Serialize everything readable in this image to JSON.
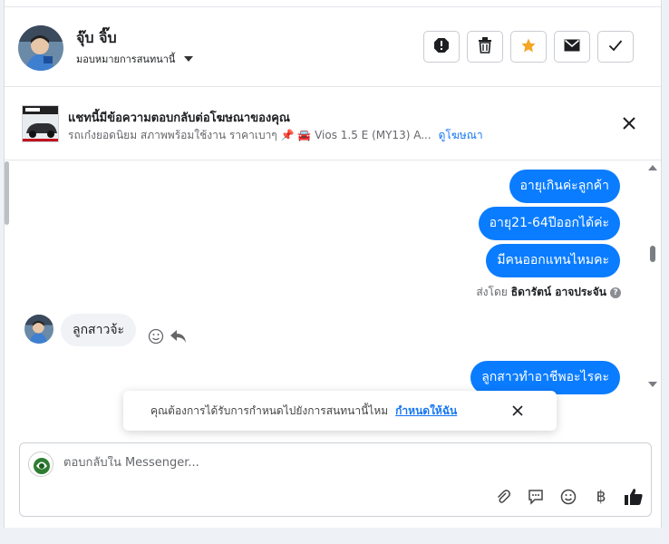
{
  "header": {
    "contact_name": "จุ๊บ จิ๊บ",
    "assign_label": "มอบหมายการสนทนานี้",
    "buttons": {
      "spam": "spam-icon",
      "delete": "trash-icon",
      "star": "star-icon",
      "mail": "envelope-icon",
      "done": "check-icon"
    }
  },
  "ad_bar": {
    "title": "แชทนี้มีข้อความตอบกลับต่อโฆษณาของคุณ",
    "subtitle": "รถเก๋งยอดนิยม สภาพพร้อมใช้งาน ราคาเบาๆ 📌 🚘 Vios 1.5 E (MY13) A...",
    "link": "ดูโฆษณา"
  },
  "messages": {
    "outgoing_top": [
      "อายุเกินค่ะลูกค้า",
      "อายุ21-64ปีออกได้ค่ะ",
      "มีคนออกแทนไหมคะ"
    ],
    "sent_by_prefix": "ส่งโดย",
    "sent_by_name": "ธิดารัตน์ อาจประจัน",
    "sent_by_help": "?",
    "incoming": "ลูกสาวจ้ะ",
    "outgoing_bottom": "ลูกสาวทำอาชีพอะไรคะ"
  },
  "toast": {
    "text": "คุณต้องการได้รับการกำหนดไปยังการสนทนานี้ไหม",
    "link": "กำหนดให้ฉัน"
  },
  "composer": {
    "placeholder": "ตอบกลับใน Messenger...",
    "baht_symbol": "฿"
  },
  "colors": {
    "accent": "#0a7cff",
    "star": "#f5a623",
    "link": "#1877f2"
  }
}
